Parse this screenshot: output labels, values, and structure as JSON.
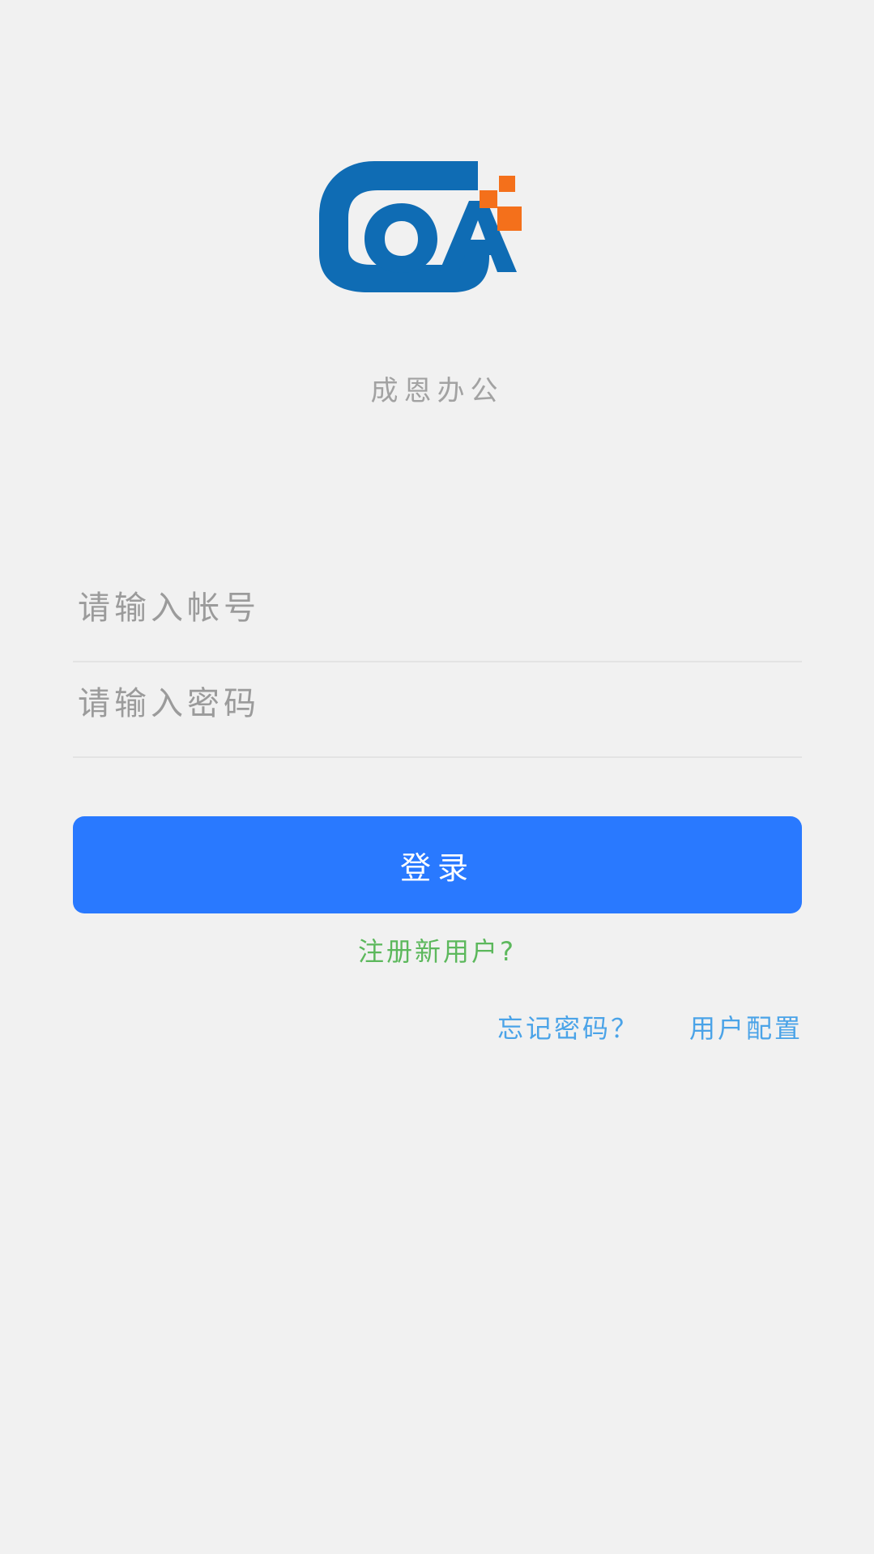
{
  "app": {
    "background_color": "#f1f1f1",
    "brand_subtitle": "成恩办公",
    "logo": {
      "name": "coa-logo",
      "letters": "OA",
      "primary_color": "#0f6cb4",
      "accent_color": "#f4701b",
      "accent_square_count": 3
    }
  },
  "form": {
    "account": {
      "placeholder": "请输入帐号",
      "value": ""
    },
    "password": {
      "placeholder": "请输入密码",
      "value": ""
    }
  },
  "actions": {
    "login_label": "登录",
    "login_color": "#2979ff",
    "register_label": "注册新用户?",
    "register_color": "#5cb85c",
    "forgot_password_label": "忘记密码？",
    "user_config_label": "用户配置",
    "bottom_link_color": "#4aa3e8"
  }
}
